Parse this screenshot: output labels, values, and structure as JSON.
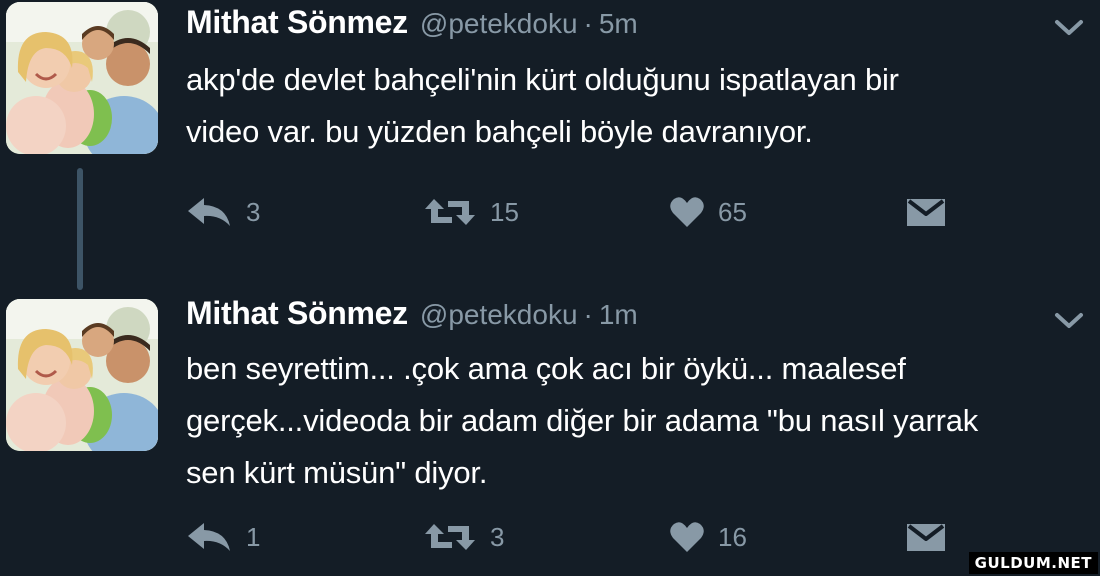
{
  "tweets": [
    {
      "name": "Mithat Sönmez",
      "handle": "@petekdoku",
      "separator": "·",
      "time": "5m",
      "lines": [
        "akp'de devlet bahçeli'nin kürt olduğunu ispatlayan bir",
        "video var. bu yüzden bahçeli böyle davranıyor."
      ],
      "replies": "3",
      "retweets": "15",
      "likes": "65"
    },
    {
      "name": "Mithat Sönmez",
      "handle": "@petekdoku",
      "separator": "·",
      "time": "1m",
      "lines": [
        "ben seyrettim... .çok ama çok acı bir öykü... maalesef",
        "gerçek...videoda bir adam diğer bir adama \"bu nasıl yarrak",
        "sen kürt müsün\" diyor."
      ],
      "replies": "1",
      "retweets": "3",
      "likes": "16"
    }
  ],
  "icons": {
    "reply": "reply-icon",
    "retweet": "retweet-icon",
    "like": "heart-icon",
    "dm": "envelope-icon",
    "caret": "chevron-down-icon"
  },
  "colors": {
    "background": "#141d26",
    "text": "#ffffff",
    "muted": "#8899a6",
    "thread_line": "#3d5466"
  },
  "watermark": "GULDUM.NET"
}
